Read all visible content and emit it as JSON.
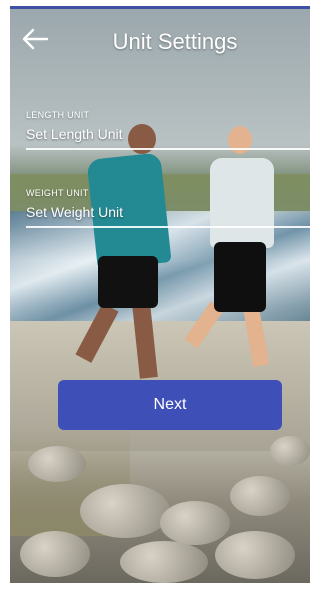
{
  "header": {
    "title": "Unit Settings",
    "back_icon": "arrow-left-icon"
  },
  "fields": {
    "length": {
      "label": "LENGTH UNIT",
      "value": "Set Length Unit"
    },
    "weight": {
      "label": "WEIGHT UNIT",
      "value": "Set Weight Unit"
    }
  },
  "actions": {
    "next_label": "Next"
  },
  "colors": {
    "primary": "#3f4fb8",
    "text": "#ffffff"
  }
}
